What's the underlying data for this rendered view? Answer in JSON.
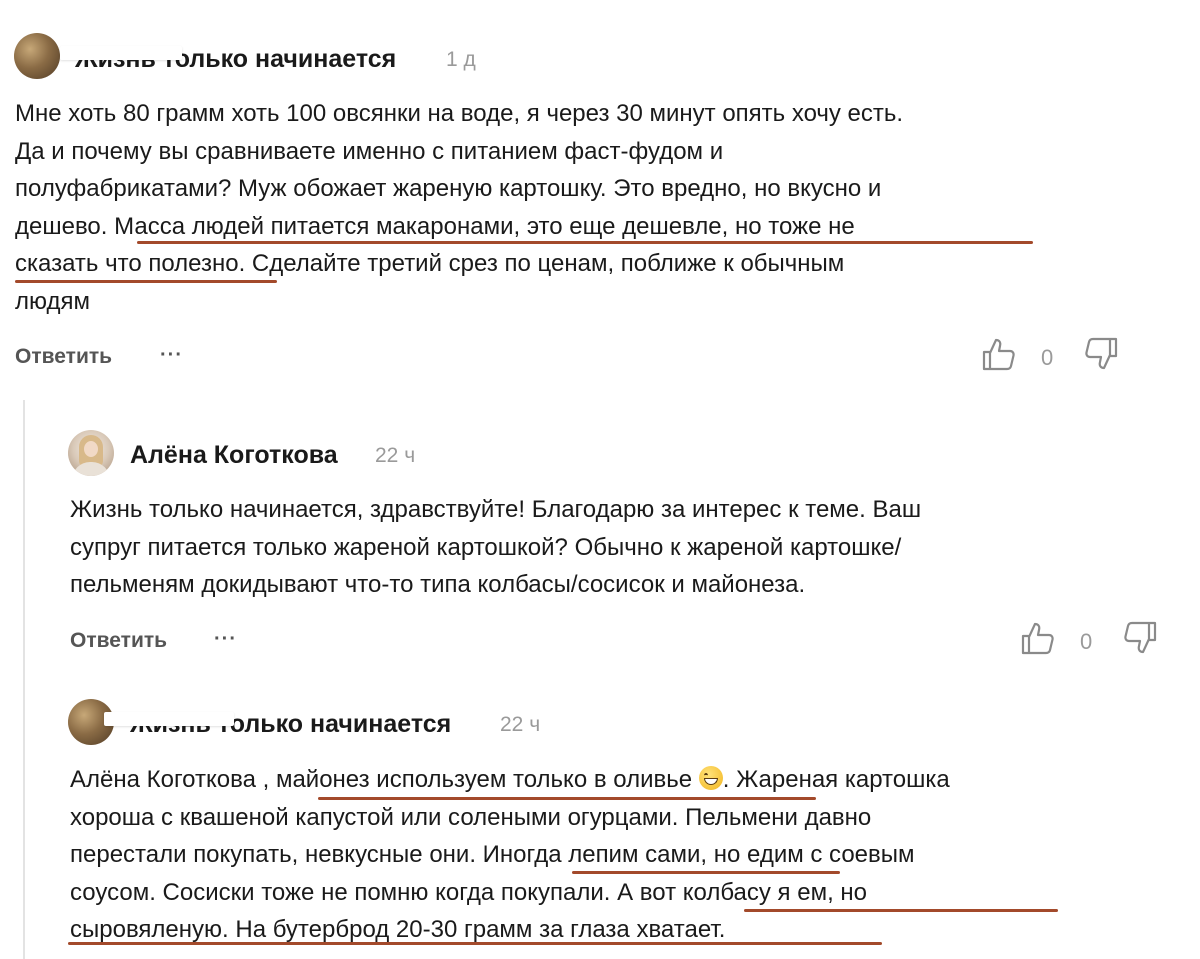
{
  "comments": [
    {
      "author": "Жизнь только начинается",
      "time": "1 д",
      "lines": [
        "Мне хоть 80 грамм хоть 100 овсянки на воде, я через 30 минут опять хочу есть.",
        "Да и почему вы сравниваете именно с питанием фаст-фудом и",
        "полуфабрикатами? Муж обожает жареную картошку. Это вредно, но вкусно и",
        "дешево. Масса людей питается макаронами, это еще дешевле, но тоже не",
        "сказать что полезно. Сделайте третий срез по ценам, поближе к обычным",
        "людям"
      ],
      "reply_label": "Ответить",
      "more_label": "···",
      "likes": "0"
    },
    {
      "author": "Алёна Коготкова",
      "time": "22 ч",
      "lines": [
        "Жизнь только начинается, здравствуйте! Благодарю за интерес к теме. Ваш",
        "супруг питается только жареной картошкой? Обычно к жареной картошке/",
        "пельменям докидывают что-то типа колбасы/сосисок и майонеза."
      ],
      "reply_label": "Ответить",
      "more_label": "···",
      "likes": "0"
    },
    {
      "author": "Жизнь только начинается",
      "time": "22 ч",
      "lines": [
        "Алёна Коготкова , майонез используем только в оливье",
        ". Жареная картошка",
        "хороша с квашеной капустой или солеными огурцами. Пельмени давно",
        "перестали покупать, невкусные они. Иногда лепим сами, но едим с соевым",
        "соусом. Сосиски тоже не помню когда покупали. А вот колбасу я ем, но",
        "сыровяленую. На бутерброд 20-30 грамм за глаза хватает."
      ]
    }
  ],
  "icons": [
    "thumbs-up-icon",
    "thumbs-down-icon",
    "more-icon",
    "grinning-emoji"
  ],
  "colors": {
    "underline": "#a34a2b",
    "text": "#1a1a1a",
    "muted": "#9a9a9a",
    "thread_line": "#e3e3e3"
  }
}
